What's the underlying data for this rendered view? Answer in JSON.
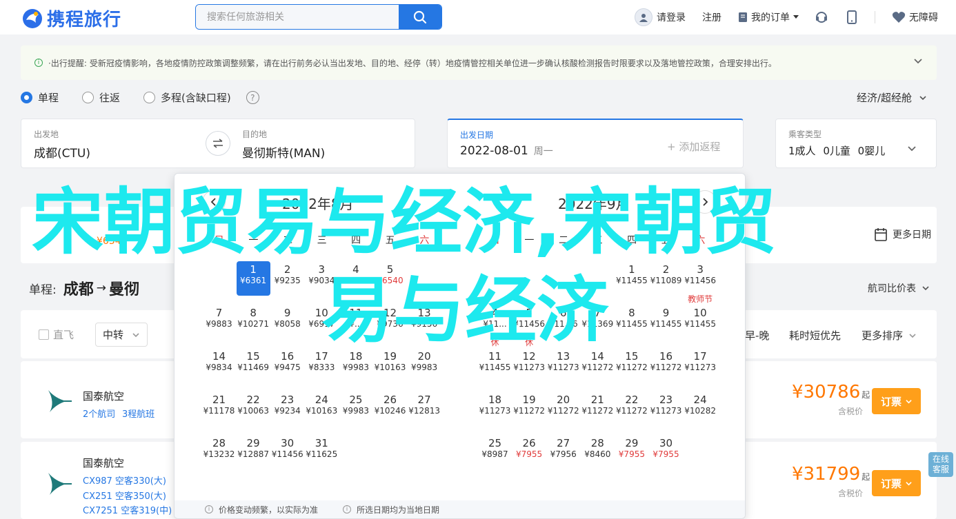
{
  "header": {
    "logo_text": "携程旅行",
    "search_placeholder": "搜索任何旅游相关",
    "login_label": "请登录",
    "register_label": "注册",
    "orders_label": "我的订单",
    "accessibility_label": "无障碍"
  },
  "notice": {
    "title": "·出行提醒:",
    "text": "受新冠疫情影响，各地疫情防控政策调整频繁，请在出行前务必认当出发地、目的地、经停（转）地疫情管控相关单位进一步确认核酸检测报告时限要求以及落地管控政策，合理安排出行。"
  },
  "trip_type": {
    "options": [
      "单程",
      "往返",
      "多程(含缺口程)"
    ],
    "selected": "单程",
    "help": "?",
    "cabin": "经济/超经舱"
  },
  "search_form": {
    "from_label": "出发地",
    "from_value": "成都(CTU)",
    "to_label": "目的地",
    "to_value": "曼彻斯特(MAN)",
    "date_label": "出发日期",
    "date_value": "2022-08-01",
    "date_weekday": "周一",
    "return_placeholder": "+ 添加返程",
    "pax_label": "乘客类型",
    "pax_adult": "1成人",
    "pax_child": "0儿童",
    "pax_infant": "0婴儿"
  },
  "results": {
    "more_days": "更多日期",
    "price_start": "¥6545",
    "route_prefix": "单程:",
    "route_from": "成都",
    "route_to": "曼彻",
    "compare": "航司比价表",
    "filters": {
      "direct": "直飞",
      "transfer": "中转",
      "early_late": "早-晚",
      "shortest": "耗时短优先",
      "more_sort": "更多排序"
    },
    "flights": [
      {
        "airline": "国泰航空",
        "links": [
          "2个航司",
          "3程航班"
        ],
        "price": "¥30786",
        "price_suffix": "起",
        "tax": "含税价",
        "book": "订票"
      },
      {
        "airline": "国泰航空",
        "links": [
          "CX987 空客330(大)",
          "CX251 空客350(大)",
          "CX7251 空客319(中)"
        ],
        "price": "¥31799",
        "price_suffix": "起",
        "tax": "含税价",
        "book": "订票"
      }
    ],
    "online_service": [
      "在线",
      "客服"
    ]
  },
  "calendar": {
    "left_title": "2022年8月",
    "right_title": "2022年9月",
    "weekdays": [
      "日",
      "一",
      "二",
      "三",
      "四",
      "五",
      "六"
    ],
    "august": [
      {
        "d": "1",
        "p": "¥6361",
        "sel": true
      },
      {
        "d": "2",
        "p": "¥9235"
      },
      {
        "d": "3",
        "p": "¥9034"
      },
      {
        "d": "4",
        "p": "¥..."
      },
      {
        "d": "5",
        "p": "¥6540",
        "low": true
      },
      {
        "d": "7",
        "p": "¥9883"
      },
      {
        "d": "8",
        "p": "¥10271"
      },
      {
        "d": "9",
        "p": "¥8058"
      },
      {
        "d": "10",
        "p": "¥6917"
      },
      {
        "d": "11",
        "p": "¥..."
      },
      {
        "d": "12",
        "p": "¥9736"
      },
      {
        "d": "13",
        "p": "¥9156"
      },
      {
        "d": "14",
        "p": "¥9834"
      },
      {
        "d": "15",
        "p": "¥11469"
      },
      {
        "d": "16",
        "p": "¥9475"
      },
      {
        "d": "17",
        "p": "¥8333"
      },
      {
        "d": "18",
        "p": "¥9983"
      },
      {
        "d": "19",
        "p": "¥10163"
      },
      {
        "d": "20",
        "p": "¥9983"
      },
      {
        "d": "21",
        "p": "¥11178"
      },
      {
        "d": "22",
        "p": "¥10063"
      },
      {
        "d": "23",
        "p": "¥9234"
      },
      {
        "d": "24",
        "p": "¥10163"
      },
      {
        "d": "25",
        "p": "¥9983"
      },
      {
        "d": "26",
        "p": "¥10246"
      },
      {
        "d": "27",
        "p": "¥12813"
      },
      {
        "d": "28",
        "p": "¥13232"
      },
      {
        "d": "29",
        "p": "¥12887"
      },
      {
        "d": "30",
        "p": "¥11456"
      },
      {
        "d": "31",
        "p": "¥11625"
      }
    ],
    "september": [
      {
        "d": "1",
        "p": "¥11455"
      },
      {
        "d": "2",
        "p": "¥11089"
      },
      {
        "d": "3",
        "p": "¥11456"
      },
      {
        "d": "4",
        "p": "¥11..."
      },
      {
        "d": "5",
        "p": "¥11456"
      },
      {
        "d": "6",
        "p": "¥11...6"
      },
      {
        "d": "7",
        "p": "¥11369"
      },
      {
        "d": "8",
        "p": "¥11455"
      },
      {
        "d": "9",
        "p": "¥11455"
      },
      {
        "d": "10",
        "p": "¥11455",
        "tag": "教师节"
      },
      {
        "d": "11",
        "p": "¥11455",
        "tag": "休"
      },
      {
        "d": "12",
        "p": "¥11273",
        "tag": "休"
      },
      {
        "d": "13",
        "p": "¥11273"
      },
      {
        "d": "14",
        "p": "¥11272"
      },
      {
        "d": "15",
        "p": "¥11272"
      },
      {
        "d": "16",
        "p": "¥11272"
      },
      {
        "d": "17",
        "p": "¥11273"
      },
      {
        "d": "18",
        "p": "¥11273"
      },
      {
        "d": "19",
        "p": "¥11272"
      },
      {
        "d": "20",
        "p": "¥11272"
      },
      {
        "d": "21",
        "p": "¥11272"
      },
      {
        "d": "22",
        "p": "¥11272"
      },
      {
        "d": "23",
        "p": "¥11273"
      },
      {
        "d": "24",
        "p": "¥10282"
      },
      {
        "d": "25",
        "p": "¥8987"
      },
      {
        "d": "26",
        "p": "¥7955",
        "low": true
      },
      {
        "d": "27",
        "p": "¥7956"
      },
      {
        "d": "28",
        "p": "¥8460"
      },
      {
        "d": "29",
        "p": "¥7955",
        "low": true
      },
      {
        "d": "30",
        "p": "¥7955",
        "low": true
      }
    ],
    "footer": [
      "价格变动频繁，以实际为准",
      "所选日期均为当地日期"
    ]
  },
  "overlay": {
    "line1": "宋朝贸易与经济,宋朝贸",
    "line2": "易与经济"
  }
}
